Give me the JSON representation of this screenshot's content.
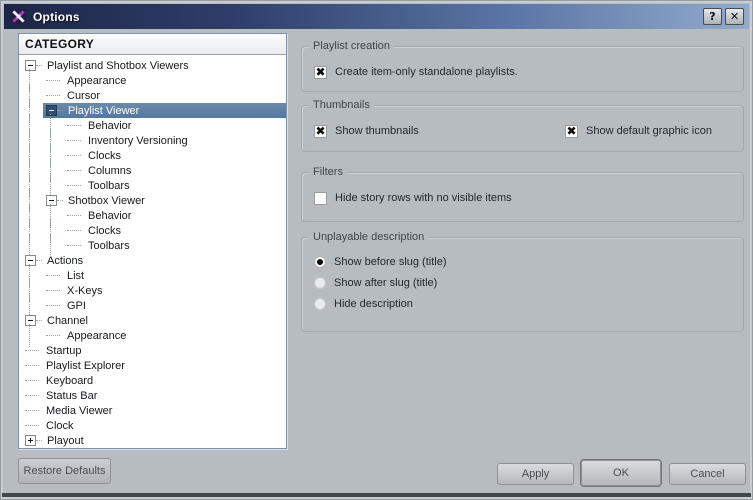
{
  "window": {
    "title": "Options",
    "help_label": "?",
    "close_label": "✕"
  },
  "icons": {
    "app_icon": "x-cross-logo",
    "check_glyph": "✖"
  },
  "colors": {
    "titlebar_dark": "#1c2646",
    "titlebar_light": "#93aacb",
    "selection_blue": "#54789c",
    "dialog_bg": "#b7bcc1",
    "tree_bg": "#ffffff"
  },
  "tree": {
    "header": "CATEGORY",
    "items": [
      {
        "label": "Playlist and Shotbox Viewers",
        "level": 0,
        "box": "minus",
        "selected": false
      },
      {
        "label": "Appearance",
        "level": 1,
        "box": "none",
        "selected": false
      },
      {
        "label": "Cursor",
        "level": 1,
        "box": "none",
        "selected": false
      },
      {
        "label": "Playlist Viewer",
        "level": 1,
        "box": "minus-dark",
        "selected": true
      },
      {
        "label": "Behavior",
        "level": 2,
        "box": "none",
        "selected": false
      },
      {
        "label": "Inventory Versioning",
        "level": 2,
        "box": "none",
        "selected": false
      },
      {
        "label": "Clocks",
        "level": 2,
        "box": "none",
        "selected": false
      },
      {
        "label": "Columns",
        "level": 2,
        "box": "none",
        "selected": false
      },
      {
        "label": "Toolbars",
        "level": 2,
        "box": "none",
        "selected": false
      },
      {
        "label": "Shotbox Viewer",
        "level": 1,
        "box": "minus",
        "selected": false
      },
      {
        "label": "Behavior",
        "level": 2,
        "box": "none",
        "selected": false
      },
      {
        "label": "Clocks",
        "level": 2,
        "box": "none",
        "selected": false
      },
      {
        "label": "Toolbars",
        "level": 2,
        "box": "none",
        "selected": false
      },
      {
        "label": "Actions",
        "level": 0,
        "box": "minus",
        "selected": false
      },
      {
        "label": "List",
        "level": 1,
        "box": "none",
        "selected": false
      },
      {
        "label": "X-Keys",
        "level": 1,
        "box": "none",
        "selected": false
      },
      {
        "label": "GPI",
        "level": 1,
        "box": "none",
        "selected": false
      },
      {
        "label": "Channel",
        "level": 0,
        "box": "minus",
        "selected": false
      },
      {
        "label": "Appearance",
        "level": 1,
        "box": "none",
        "selected": false
      },
      {
        "label": "Startup",
        "level": 0,
        "box": "none",
        "selected": false
      },
      {
        "label": "Playlist Explorer",
        "level": 0,
        "box": "none",
        "selected": false
      },
      {
        "label": "Keyboard",
        "level": 0,
        "box": "none",
        "selected": false
      },
      {
        "label": "Status Bar",
        "level": 0,
        "box": "none",
        "selected": false
      },
      {
        "label": "Media Viewer",
        "level": 0,
        "box": "none",
        "selected": false
      },
      {
        "label": "Clock",
        "level": 0,
        "box": "none",
        "selected": false
      },
      {
        "label": "Playout",
        "level": 0,
        "box": "plus",
        "selected": false
      }
    ]
  },
  "groups": [
    {
      "title": "Playlist creation",
      "controls": [
        {
          "type": "checkbox",
          "checked": true,
          "label": "Create item-only standalone playlists."
        }
      ]
    },
    {
      "title": "Thumbnails",
      "controls": [
        {
          "type": "checkbox",
          "checked": true,
          "label": "Show thumbnails"
        },
        {
          "type": "checkbox",
          "checked": true,
          "label": "Show default graphic icon"
        }
      ]
    },
    {
      "title": "Filters",
      "controls": [
        {
          "type": "checkbox",
          "checked": false,
          "label": "Hide story rows with no visible items"
        }
      ]
    },
    {
      "title": "Unplayable description",
      "controls": [
        {
          "type": "radio",
          "checked": true,
          "label": "Show before slug (title)"
        },
        {
          "type": "radio",
          "checked": false,
          "label": "Show after slug (title)"
        },
        {
          "type": "radio",
          "checked": false,
          "label": "Hide description"
        }
      ]
    }
  ],
  "buttons": {
    "restore": "Restore Defaults",
    "apply": "Apply",
    "ok": "OK",
    "cancel": "Cancel"
  }
}
